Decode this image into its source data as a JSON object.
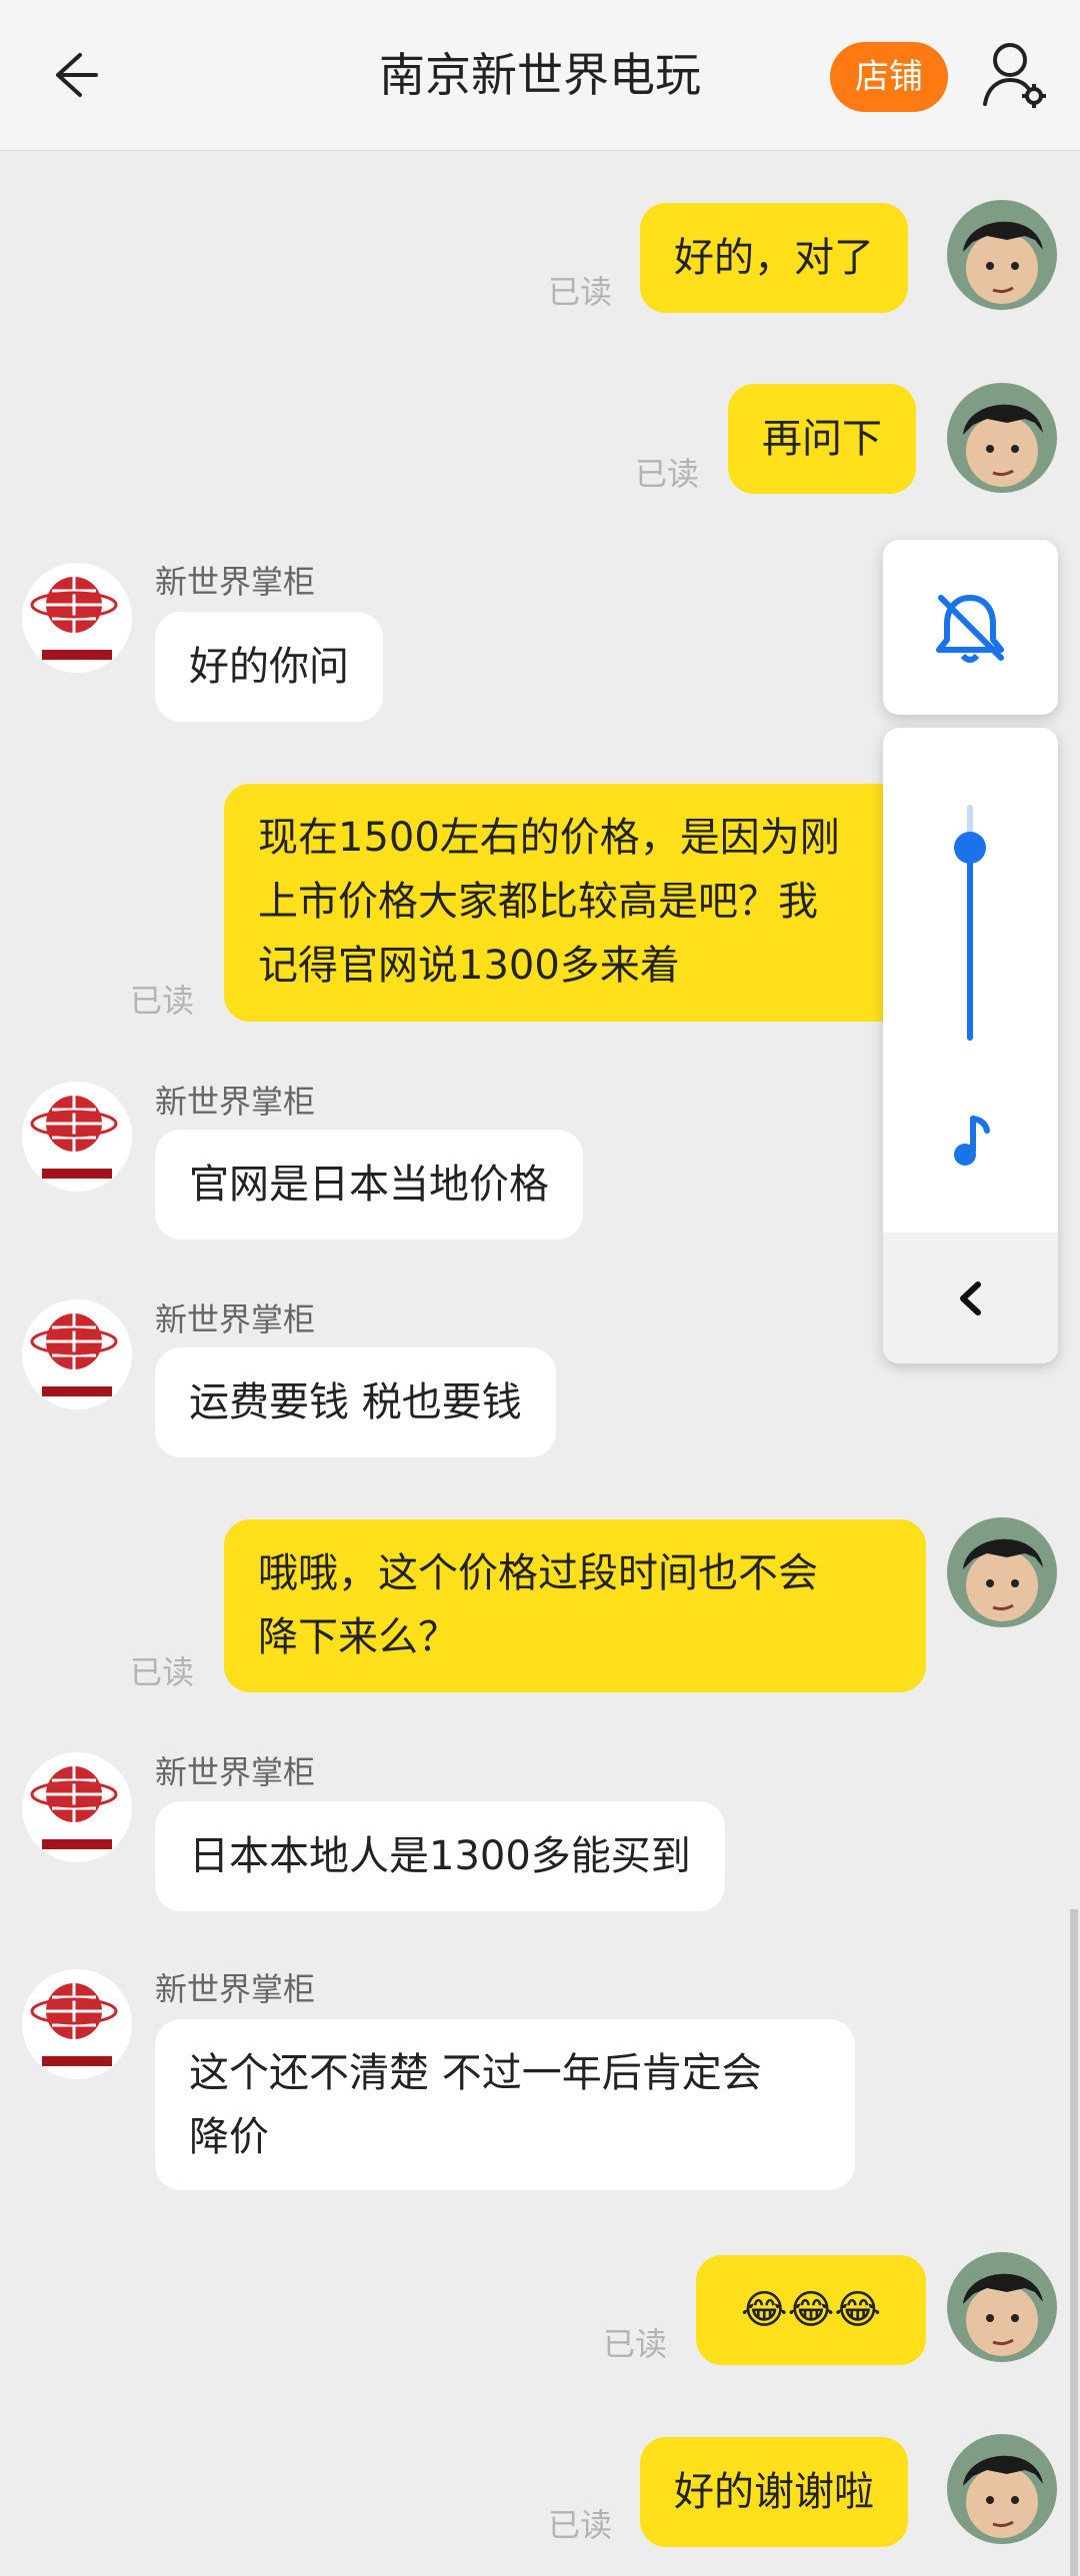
{
  "header": {
    "title": "南京新世界电玩",
    "shop_label": "店铺"
  },
  "read_label": "已读",
  "sender_name": "新世界掌柜",
  "messages": [
    {
      "text": "好的，对了"
    },
    {
      "text": "再问下"
    },
    {
      "text": "好的你问"
    },
    {
      "line1": "现在1500左右的价格，是因为刚",
      "line2": "上市价格大家都比较高是吧？我",
      "line3": "记得官网说1300多来着"
    },
    {
      "text": "官网是日本当地价格"
    },
    {
      "text": "运费要钱 税也要钱"
    },
    {
      "line1": "哦哦，这个价格过段时间也不会",
      "line2": "降下来么？"
    },
    {
      "text": "日本本地人是1300多能买到"
    },
    {
      "line1": "这个还不清楚 不过一年后肯定会",
      "line2": "降价"
    },
    {
      "text": "😂😂😂"
    },
    {
      "text": "好的谢谢啦"
    }
  ],
  "colors": {
    "accent": "#ff7a12",
    "my_bubble": "#ffe01b",
    "volume_blue": "#1a73e8"
  },
  "icons": {
    "back": "arrow-left-icon",
    "settings": "user-settings-icon",
    "mute": "bell-off-icon",
    "media": "music-note-icon",
    "expand": "chevron-left-icon"
  }
}
